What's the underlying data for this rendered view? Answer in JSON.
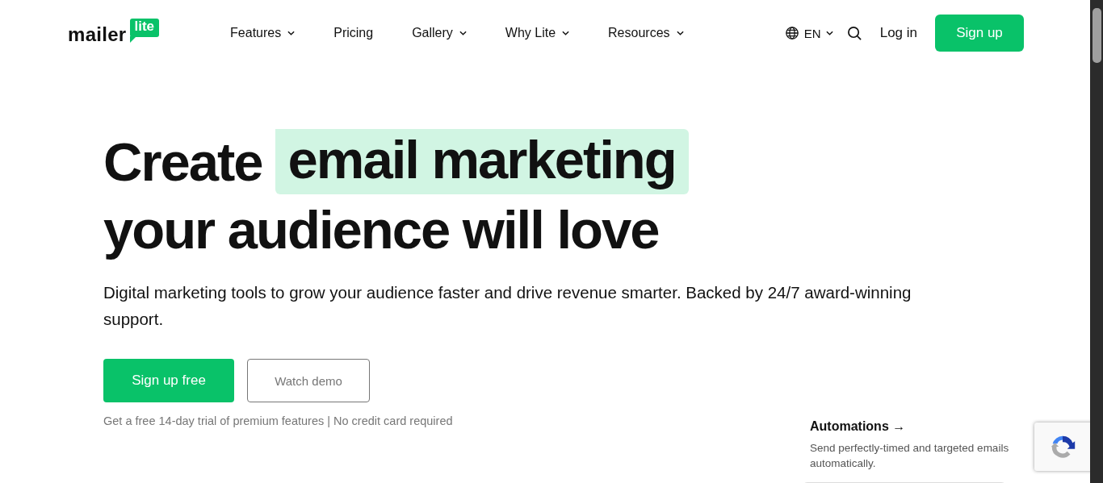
{
  "logo": {
    "word": "mailer",
    "badge": "lite"
  },
  "nav": [
    {
      "label": "Features",
      "has_menu": true
    },
    {
      "label": "Pricing",
      "has_menu": false
    },
    {
      "label": "Gallery",
      "has_menu": true
    },
    {
      "label": "Why Lite",
      "has_menu": true
    },
    {
      "label": "Resources",
      "has_menu": true
    }
  ],
  "language": {
    "label": "EN",
    "has_menu": true
  },
  "login": "Log in",
  "signup": "Sign up",
  "hero": {
    "title_start": "Create",
    "title_highlight": "email marketing",
    "title_end": "your audience will love",
    "subtitle": "Digital marketing tools to grow your audience faster and drive revenue smarter. Backed by 24/7 award-winning support.",
    "primary_button": "Sign up free",
    "secondary_button": "Watch demo",
    "note": "Get a free 14-day trial of premium features | No credit card required"
  },
  "feature_card": {
    "title": "Automations",
    "arrow": "→",
    "text": "Send perfectly-timed and targeted emails automatically."
  }
}
